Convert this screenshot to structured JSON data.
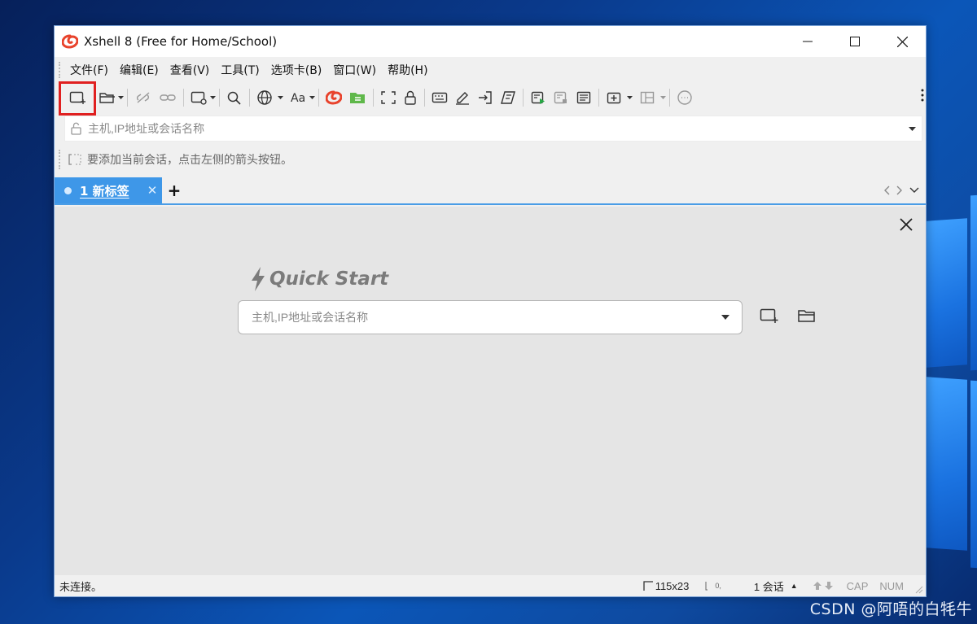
{
  "window": {
    "title": "Xshell 8 (Free for Home/School)"
  },
  "menu": {
    "items": [
      "文件(F)",
      "编辑(E)",
      "查看(V)",
      "工具(T)",
      "选项卡(B)",
      "窗口(W)",
      "帮助(H)"
    ]
  },
  "toolbar": {
    "icons": [
      "new-session-icon",
      "open-folder-icon",
      "disconnect-icon",
      "reconnect-icon",
      "new-tab-settings-icon",
      "search-icon",
      "globe-icon",
      "font-icon",
      "xshell-icon",
      "xftp-icon",
      "fullscreen-icon",
      "lock-icon",
      "keyboard-icon",
      "compose-icon",
      "transfer-icon",
      "script-icon",
      "log-icon",
      "log-stop-icon",
      "notes-icon",
      "add-folder-icon",
      "layout-icon",
      "chat-icon"
    ],
    "highlight_color": "#e02020"
  },
  "address_bar": {
    "placeholder": "主机,IP地址或会话名称"
  },
  "hint": {
    "text": "要添加当前会话，点击左侧的箭头按钮。"
  },
  "tabs": [
    {
      "label": "1 新标签",
      "active": true
    }
  ],
  "tab_add_label": "+",
  "quick_start": {
    "title": "Quick Start",
    "placeholder": "主机,IP地址或会话名称"
  },
  "status": {
    "connection": "未连接。",
    "dimensions": "115x23",
    "position": "0,",
    "sessions": "1 会话",
    "cap": "CAP",
    "num": "NUM"
  },
  "colors": {
    "tab_active": "#3e97e8",
    "tab_border": "#4a9de6",
    "content_bg": "#e5e5e5"
  },
  "watermark": "CSDN @阿唔的白牦牛"
}
